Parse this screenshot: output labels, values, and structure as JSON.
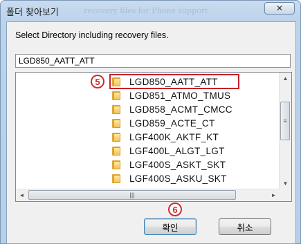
{
  "window": {
    "title": "폴더 찾아보기",
    "close_glyph": "✕",
    "background_text": "recovery files for Phone support"
  },
  "dialog": {
    "prompt": "Select Directory including recovery files.",
    "path_value": "LGD850_AATT_ATT"
  },
  "tree": {
    "items": [
      {
        "label": "LGD850_AATT_ATT",
        "selected": true
      },
      {
        "label": "LGD851_ATMO_TMUS"
      },
      {
        "label": "LGD858_ACMT_CMCC"
      },
      {
        "label": "LGD859_ACTE_CT"
      },
      {
        "label": "LGF400K_AKTF_KT"
      },
      {
        "label": "LGF400L_ALGT_LGT"
      },
      {
        "label": "LGF400S_ASKT_SKT"
      },
      {
        "label": "LGF400S_ASKU_SKT"
      }
    ],
    "icon": "folder-icon"
  },
  "scrollbars": {
    "up": "▲",
    "down": "▼",
    "left": "◄",
    "right": "►",
    "grip_v": "≡",
    "grip_h": "|||"
  },
  "annotations": {
    "step5": "5",
    "step6": "6",
    "color": "#d42a2a"
  },
  "buttons": {
    "ok": "확인",
    "cancel": "취소"
  }
}
